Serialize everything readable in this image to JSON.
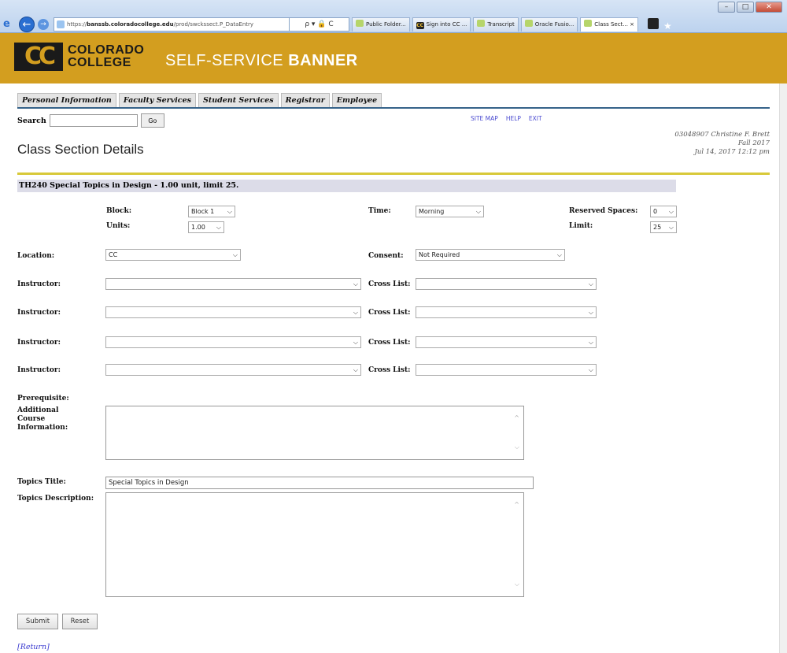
{
  "browser": {
    "url_prefix": "https://",
    "url_host": "banssb.coloradocollege.edu",
    "url_path": "/prod/swckssect.P_DataEntry",
    "addr_icons": "ρ ▾ 🔒 C",
    "tabs": [
      {
        "label": "Public Folder...",
        "icon": "page"
      },
      {
        "label": "Sign into CC ...",
        "icon": "cc"
      },
      {
        "label": "Transcript",
        "icon": "page"
      },
      {
        "label": "Oracle Fusio...",
        "icon": "page"
      },
      {
        "label": "Class Sect... ×",
        "icon": "page",
        "active": true
      }
    ]
  },
  "header": {
    "logo_text": "CC",
    "college_line1": "COLORADO",
    "college_line2": "COLLEGE",
    "title_prefix": "SELF-SERVICE ",
    "title_bold": "BANNER"
  },
  "nav": {
    "tabs": [
      "Personal Information",
      "Faculty Services",
      "Student Services",
      "Registrar",
      "Employee"
    ]
  },
  "search": {
    "label": "Search",
    "button": "Go"
  },
  "toplinks": [
    "SITE MAP",
    "HELP",
    "EXIT"
  ],
  "user": {
    "id_name": "03048907 Christine F. Brett",
    "term": "Fall 2017",
    "datetime": "Jul 14, 2017 12:12 pm"
  },
  "page_title": "Class Section Details",
  "section_header": "TH240 Special Topics in Design - 1.00 unit, limit 25.",
  "form": {
    "block_label": "Block:",
    "block_value": "Block 1",
    "units_label": "Units:",
    "units_value": "1.00",
    "time_label": "Time:",
    "time_value": "Morning",
    "reserved_label": "Reserved Spaces:",
    "reserved_value": "0",
    "limit_label": "Limit:",
    "limit_value": "25",
    "location_label": "Location:",
    "location_value": "CC",
    "consent_label": "Consent:",
    "consent_value": "Not Required",
    "instructor_label": "Instructor:",
    "crosslist_label": "Cross List:",
    "prereq_label": "Prerequisite:",
    "addl_label_1": "Additional",
    "addl_label_2": "Course",
    "addl_label_3": "Information:",
    "topics_title_label": "Topics Title:",
    "topics_title_value": "Special Topics in Design",
    "topics_desc_label": "Topics Description:",
    "submit": "Submit",
    "reset": "Reset",
    "return": "[Return]"
  }
}
